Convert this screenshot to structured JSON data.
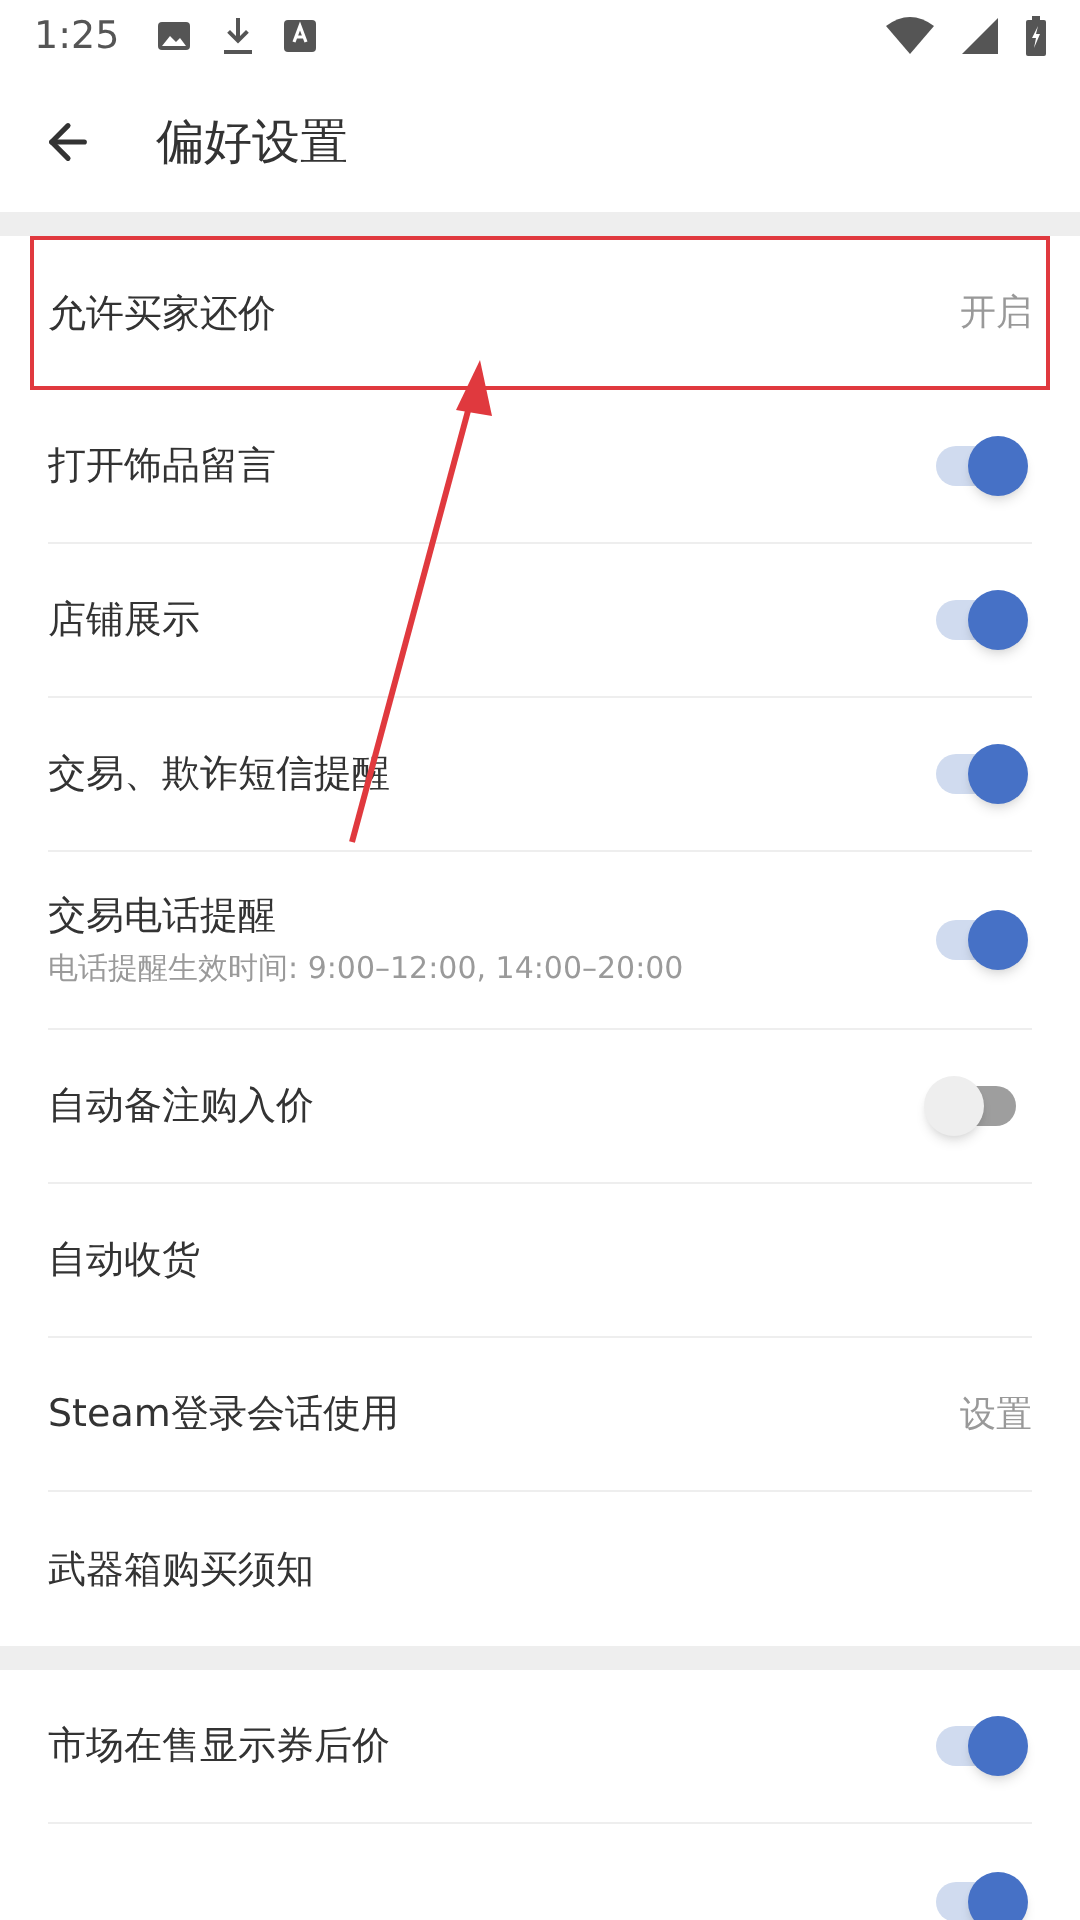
{
  "status_bar": {
    "time": "1:25"
  },
  "header": {
    "title": "偏好设置"
  },
  "sections": [
    {
      "items": [
        {
          "kind": "value",
          "label": "允许买家还价",
          "value": "开启",
          "highlighted": true
        },
        {
          "kind": "toggle",
          "label": "打开饰品留言",
          "on": true
        },
        {
          "kind": "toggle",
          "label": "店铺展示",
          "on": true
        },
        {
          "kind": "toggle",
          "label": "交易、欺诈短信提醒",
          "on": true
        },
        {
          "kind": "toggle",
          "label": "交易电话提醒",
          "subtitle": "电话提醒生效时间: 9:00–12:00, 14:00–20:00",
          "on": true
        },
        {
          "kind": "toggle",
          "label": "自动备注购入价",
          "on": false
        },
        {
          "kind": "plain",
          "label": "自动收货"
        },
        {
          "kind": "value",
          "label": "Steam登录会话使用",
          "value": "设置"
        },
        {
          "kind": "plain",
          "label": "武器箱购买须知"
        }
      ]
    },
    {
      "items": [
        {
          "kind": "toggle",
          "label": "市场在售显示券后价",
          "on": true
        },
        {
          "kind": "toggle",
          "on": true
        }
      ]
    }
  ]
}
